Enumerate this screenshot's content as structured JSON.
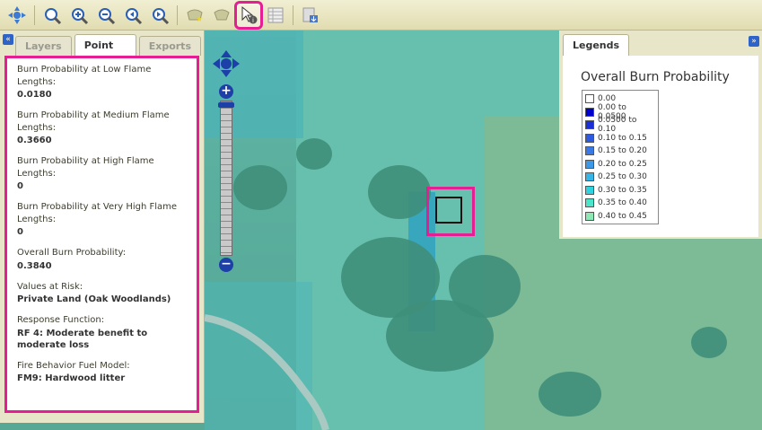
{
  "toolbar": {
    "buttons": [
      {
        "name": "pan-tool-icon"
      },
      {
        "name": "zoom-full-extent-icon"
      },
      {
        "name": "zoom-in-icon"
      },
      {
        "name": "zoom-out-icon"
      },
      {
        "name": "zoom-previous-icon"
      },
      {
        "name": "zoom-next-icon"
      },
      {
        "name": "draw-point-icon"
      },
      {
        "name": "draw-polygon-icon"
      },
      {
        "name": "identify-tool-icon"
      },
      {
        "name": "table-icon"
      },
      {
        "name": "export-map-icon"
      }
    ],
    "active_tool": "identify-tool-icon"
  },
  "left_panel": {
    "tabs": [
      {
        "label": "Layers",
        "active": false
      },
      {
        "label": "Point Info",
        "active": true
      },
      {
        "label": "Exports",
        "active": false
      }
    ],
    "fields": [
      {
        "label": "Burn Probability at Low Flame Lengths:",
        "value": "0.0180"
      },
      {
        "label": "Burn Probability at Medium Flame Lengths:",
        "value": "0.3660"
      },
      {
        "label": "Burn Probability at High Flame Lengths:",
        "value": "0"
      },
      {
        "label": "Burn Probability at Very High Flame Lengths:",
        "value": "0"
      },
      {
        "label": "Overall Burn Probability:",
        "value": "0.3840"
      },
      {
        "label": "Values at Risk:",
        "value": "Private Land (Oak Woodlands)"
      },
      {
        "label": "Response Function:",
        "value": "RF 4: Moderate benefit to moderate loss"
      },
      {
        "label": "Fire Behavior Fuel Model:",
        "value": "FM9: Hardwood litter"
      }
    ]
  },
  "legend": {
    "tab_label": "Legends",
    "title": "Overall Burn Probability",
    "items": [
      {
        "label": "0.00",
        "color": "#ffffff"
      },
      {
        "label": "0.00 to 0.0500",
        "color": "#0000cc"
      },
      {
        "label": "0.0500 to 0.10",
        "color": "#1a2fd6"
      },
      {
        "label": "0.10 to 0.15",
        "color": "#2e5ae0"
      },
      {
        "label": "0.15 to 0.20",
        "color": "#3a78e6"
      },
      {
        "label": "0.20 to 0.25",
        "color": "#3d98e8"
      },
      {
        "label": "0.25 to 0.30",
        "color": "#36b6e6"
      },
      {
        "label": "0.30 to 0.35",
        "color": "#2fd3e0"
      },
      {
        "label": "0.35 to 0.40",
        "color": "#4ae6cc"
      },
      {
        "label": "0.40 to 0.45",
        "color": "#8ee8b4"
      }
    ]
  },
  "colors": {
    "highlight": "#e51e93",
    "toolbar_bg": "#e8e4bf",
    "map_tint": "#5aae9d"
  }
}
